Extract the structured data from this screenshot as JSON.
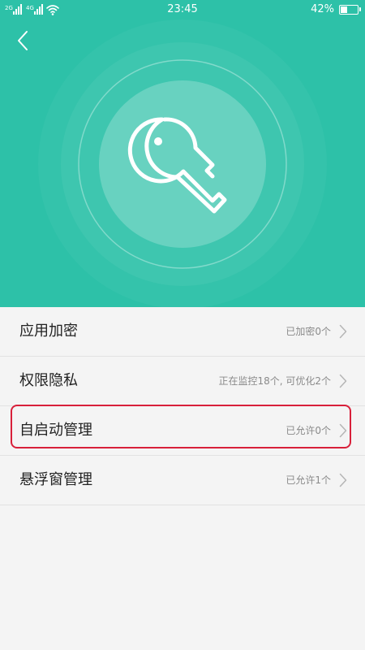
{
  "status_bar": {
    "network_left": "2G",
    "network_right": "4G",
    "clock": "23:45",
    "battery_percent_text": "42%",
    "battery_level": 0.42
  },
  "colors": {
    "hero_background": "#2dc1a8",
    "list_background": "#f4f4f4",
    "highlight_border": "#d8203a"
  },
  "header": {
    "back_icon": "chevron-left-icon",
    "hero_icon": "key-icon"
  },
  "settings": {
    "items": [
      {
        "label": "应用加密",
        "value": "已加密0个"
      },
      {
        "label": "权限隐私",
        "value": "正在监控18个, 可优化2个"
      },
      {
        "label": "自启动管理",
        "value": "已允许0个"
      },
      {
        "label": "悬浮窗管理",
        "value": "已允许1个"
      }
    ]
  }
}
